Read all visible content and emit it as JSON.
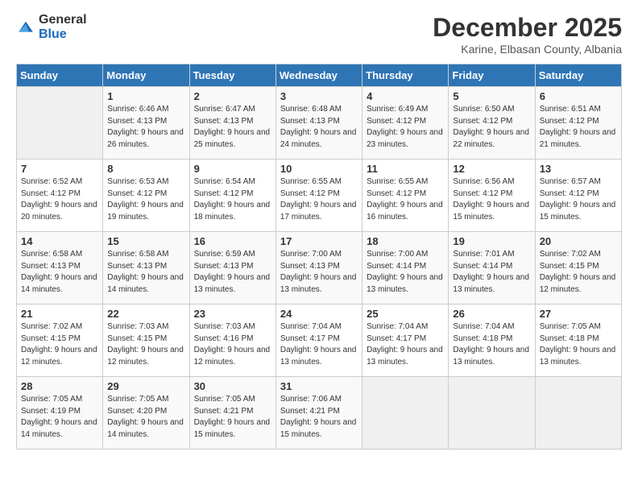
{
  "logo": {
    "general": "General",
    "blue": "Blue"
  },
  "header": {
    "title": "December 2025",
    "subtitle": "Karine, Elbasan County, Albania"
  },
  "days_of_week": [
    "Sunday",
    "Monday",
    "Tuesday",
    "Wednesday",
    "Thursday",
    "Friday",
    "Saturday"
  ],
  "weeks": [
    [
      {
        "day": "",
        "sunrise": "",
        "sunset": "",
        "daylight": ""
      },
      {
        "day": "1",
        "sunrise": "Sunrise: 6:46 AM",
        "sunset": "Sunset: 4:13 PM",
        "daylight": "Daylight: 9 hours and 26 minutes."
      },
      {
        "day": "2",
        "sunrise": "Sunrise: 6:47 AM",
        "sunset": "Sunset: 4:13 PM",
        "daylight": "Daylight: 9 hours and 25 minutes."
      },
      {
        "day": "3",
        "sunrise": "Sunrise: 6:48 AM",
        "sunset": "Sunset: 4:13 PM",
        "daylight": "Daylight: 9 hours and 24 minutes."
      },
      {
        "day": "4",
        "sunrise": "Sunrise: 6:49 AM",
        "sunset": "Sunset: 4:12 PM",
        "daylight": "Daylight: 9 hours and 23 minutes."
      },
      {
        "day": "5",
        "sunrise": "Sunrise: 6:50 AM",
        "sunset": "Sunset: 4:12 PM",
        "daylight": "Daylight: 9 hours and 22 minutes."
      },
      {
        "day": "6",
        "sunrise": "Sunrise: 6:51 AM",
        "sunset": "Sunset: 4:12 PM",
        "daylight": "Daylight: 9 hours and 21 minutes."
      }
    ],
    [
      {
        "day": "7",
        "sunrise": "Sunrise: 6:52 AM",
        "sunset": "Sunset: 4:12 PM",
        "daylight": "Daylight: 9 hours and 20 minutes."
      },
      {
        "day": "8",
        "sunrise": "Sunrise: 6:53 AM",
        "sunset": "Sunset: 4:12 PM",
        "daylight": "Daylight: 9 hours and 19 minutes."
      },
      {
        "day": "9",
        "sunrise": "Sunrise: 6:54 AM",
        "sunset": "Sunset: 4:12 PM",
        "daylight": "Daylight: 9 hours and 18 minutes."
      },
      {
        "day": "10",
        "sunrise": "Sunrise: 6:55 AM",
        "sunset": "Sunset: 4:12 PM",
        "daylight": "Daylight: 9 hours and 17 minutes."
      },
      {
        "day": "11",
        "sunrise": "Sunrise: 6:55 AM",
        "sunset": "Sunset: 4:12 PM",
        "daylight": "Daylight: 9 hours and 16 minutes."
      },
      {
        "day": "12",
        "sunrise": "Sunrise: 6:56 AM",
        "sunset": "Sunset: 4:12 PM",
        "daylight": "Daylight: 9 hours and 15 minutes."
      },
      {
        "day": "13",
        "sunrise": "Sunrise: 6:57 AM",
        "sunset": "Sunset: 4:12 PM",
        "daylight": "Daylight: 9 hours and 15 minutes."
      }
    ],
    [
      {
        "day": "14",
        "sunrise": "Sunrise: 6:58 AM",
        "sunset": "Sunset: 4:13 PM",
        "daylight": "Daylight: 9 hours and 14 minutes."
      },
      {
        "day": "15",
        "sunrise": "Sunrise: 6:58 AM",
        "sunset": "Sunset: 4:13 PM",
        "daylight": "Daylight: 9 hours and 14 minutes."
      },
      {
        "day": "16",
        "sunrise": "Sunrise: 6:59 AM",
        "sunset": "Sunset: 4:13 PM",
        "daylight": "Daylight: 9 hours and 13 minutes."
      },
      {
        "day": "17",
        "sunrise": "Sunrise: 7:00 AM",
        "sunset": "Sunset: 4:13 PM",
        "daylight": "Daylight: 9 hours and 13 minutes."
      },
      {
        "day": "18",
        "sunrise": "Sunrise: 7:00 AM",
        "sunset": "Sunset: 4:14 PM",
        "daylight": "Daylight: 9 hours and 13 minutes."
      },
      {
        "day": "19",
        "sunrise": "Sunrise: 7:01 AM",
        "sunset": "Sunset: 4:14 PM",
        "daylight": "Daylight: 9 hours and 13 minutes."
      },
      {
        "day": "20",
        "sunrise": "Sunrise: 7:02 AM",
        "sunset": "Sunset: 4:15 PM",
        "daylight": "Daylight: 9 hours and 12 minutes."
      }
    ],
    [
      {
        "day": "21",
        "sunrise": "Sunrise: 7:02 AM",
        "sunset": "Sunset: 4:15 PM",
        "daylight": "Daylight: 9 hours and 12 minutes."
      },
      {
        "day": "22",
        "sunrise": "Sunrise: 7:03 AM",
        "sunset": "Sunset: 4:15 PM",
        "daylight": "Daylight: 9 hours and 12 minutes."
      },
      {
        "day": "23",
        "sunrise": "Sunrise: 7:03 AM",
        "sunset": "Sunset: 4:16 PM",
        "daylight": "Daylight: 9 hours and 12 minutes."
      },
      {
        "day": "24",
        "sunrise": "Sunrise: 7:04 AM",
        "sunset": "Sunset: 4:17 PM",
        "daylight": "Daylight: 9 hours and 13 minutes."
      },
      {
        "day": "25",
        "sunrise": "Sunrise: 7:04 AM",
        "sunset": "Sunset: 4:17 PM",
        "daylight": "Daylight: 9 hours and 13 minutes."
      },
      {
        "day": "26",
        "sunrise": "Sunrise: 7:04 AM",
        "sunset": "Sunset: 4:18 PM",
        "daylight": "Daylight: 9 hours and 13 minutes."
      },
      {
        "day": "27",
        "sunrise": "Sunrise: 7:05 AM",
        "sunset": "Sunset: 4:18 PM",
        "daylight": "Daylight: 9 hours and 13 minutes."
      }
    ],
    [
      {
        "day": "28",
        "sunrise": "Sunrise: 7:05 AM",
        "sunset": "Sunset: 4:19 PM",
        "daylight": "Daylight: 9 hours and 14 minutes."
      },
      {
        "day": "29",
        "sunrise": "Sunrise: 7:05 AM",
        "sunset": "Sunset: 4:20 PM",
        "daylight": "Daylight: 9 hours and 14 minutes."
      },
      {
        "day": "30",
        "sunrise": "Sunrise: 7:05 AM",
        "sunset": "Sunset: 4:21 PM",
        "daylight": "Daylight: 9 hours and 15 minutes."
      },
      {
        "day": "31",
        "sunrise": "Sunrise: 7:06 AM",
        "sunset": "Sunset: 4:21 PM",
        "daylight": "Daylight: 9 hours and 15 minutes."
      },
      {
        "day": "",
        "sunrise": "",
        "sunset": "",
        "daylight": ""
      },
      {
        "day": "",
        "sunrise": "",
        "sunset": "",
        "daylight": ""
      },
      {
        "day": "",
        "sunrise": "",
        "sunset": "",
        "daylight": ""
      }
    ]
  ]
}
